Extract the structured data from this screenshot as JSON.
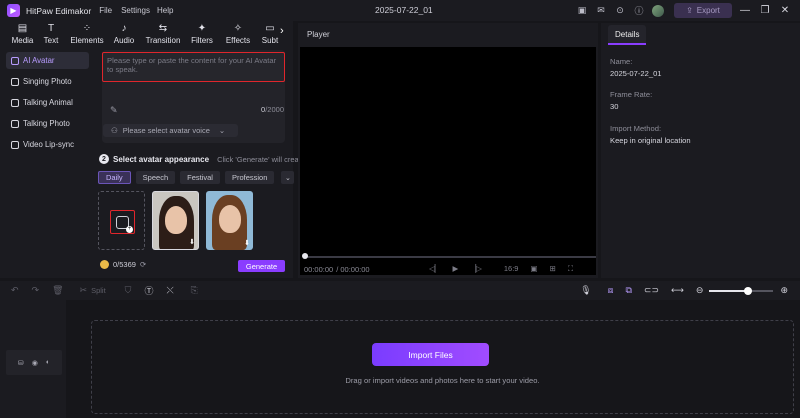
{
  "app": {
    "title": "HitPaw Edimakor",
    "menu": [
      "File",
      "Settings",
      "Help"
    ],
    "document_title": "2025-07-22_01",
    "export_label": "Export",
    "accent_color": "#8a3dff"
  },
  "toolbar": {
    "tools": [
      {
        "label": "Media",
        "icon": "media-icon"
      },
      {
        "label": "Text",
        "icon": "text-icon"
      },
      {
        "label": "Elements",
        "icon": "elements-icon"
      },
      {
        "label": "Audio",
        "icon": "audio-icon"
      },
      {
        "label": "Transition",
        "icon": "transition-icon"
      },
      {
        "label": "Filters",
        "icon": "filters-icon"
      },
      {
        "label": "Effects",
        "icon": "effects-icon"
      },
      {
        "label": "Subt",
        "icon": "subtitle-icon"
      }
    ]
  },
  "leftnav": {
    "items": [
      "AI Avatar",
      "Singing Photo",
      "Talking Animal",
      "Talking Photo",
      "Video Lip-sync"
    ],
    "active_index": 0
  },
  "avatar_panel": {
    "script_placeholder": "Please type or paste the content for your AI Avatar to speak.",
    "char_count": "0",
    "char_limit": "/2000",
    "voice_placeholder": "Please select avatar voice",
    "step_number": "2",
    "step_title": "Select avatar appearance",
    "step_hint": "Click 'Generate' will creat",
    "categories": [
      "Daily",
      "Speech",
      "Festival",
      "Profession"
    ],
    "active_category": "Daily",
    "credits": "0/5369",
    "generate_label": "Generate"
  },
  "player": {
    "label": "Player",
    "current_time": "00:00:00",
    "total_time": "/ 00:00:00",
    "aspect_ratio": "16:9"
  },
  "details": {
    "tab_label": "Details",
    "fields": [
      {
        "label": "Name:",
        "value": "2025-07-22_01"
      },
      {
        "label": "Frame Rate:",
        "value": "30"
      },
      {
        "label": "Import Method:",
        "value": "Keep in original location"
      }
    ]
  },
  "timeline": {
    "split_label": "Split",
    "zoom_level": 0.6,
    "import_label": "Import Files",
    "drop_hint": "Drag or import videos and photos here to start your video."
  }
}
